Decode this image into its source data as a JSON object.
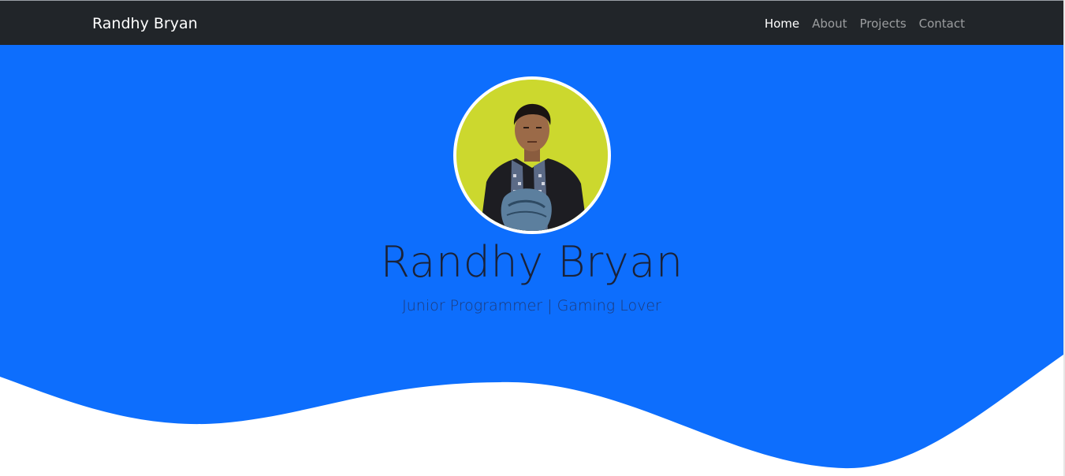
{
  "navbar": {
    "brand": "Randhy Bryan",
    "links": [
      {
        "label": "Home",
        "active": true
      },
      {
        "label": "About",
        "active": false
      },
      {
        "label": "Projects",
        "active": false
      },
      {
        "label": "Contact",
        "active": false
      }
    ]
  },
  "hero": {
    "avatar_icon": "profile-photo",
    "title": "Randhy Bryan",
    "subtitle": "Junior Programmer | Gaming Lover"
  },
  "colors": {
    "navbar_bg": "#212529",
    "hero_bg": "#0d6efd",
    "background": "#ffffff"
  }
}
